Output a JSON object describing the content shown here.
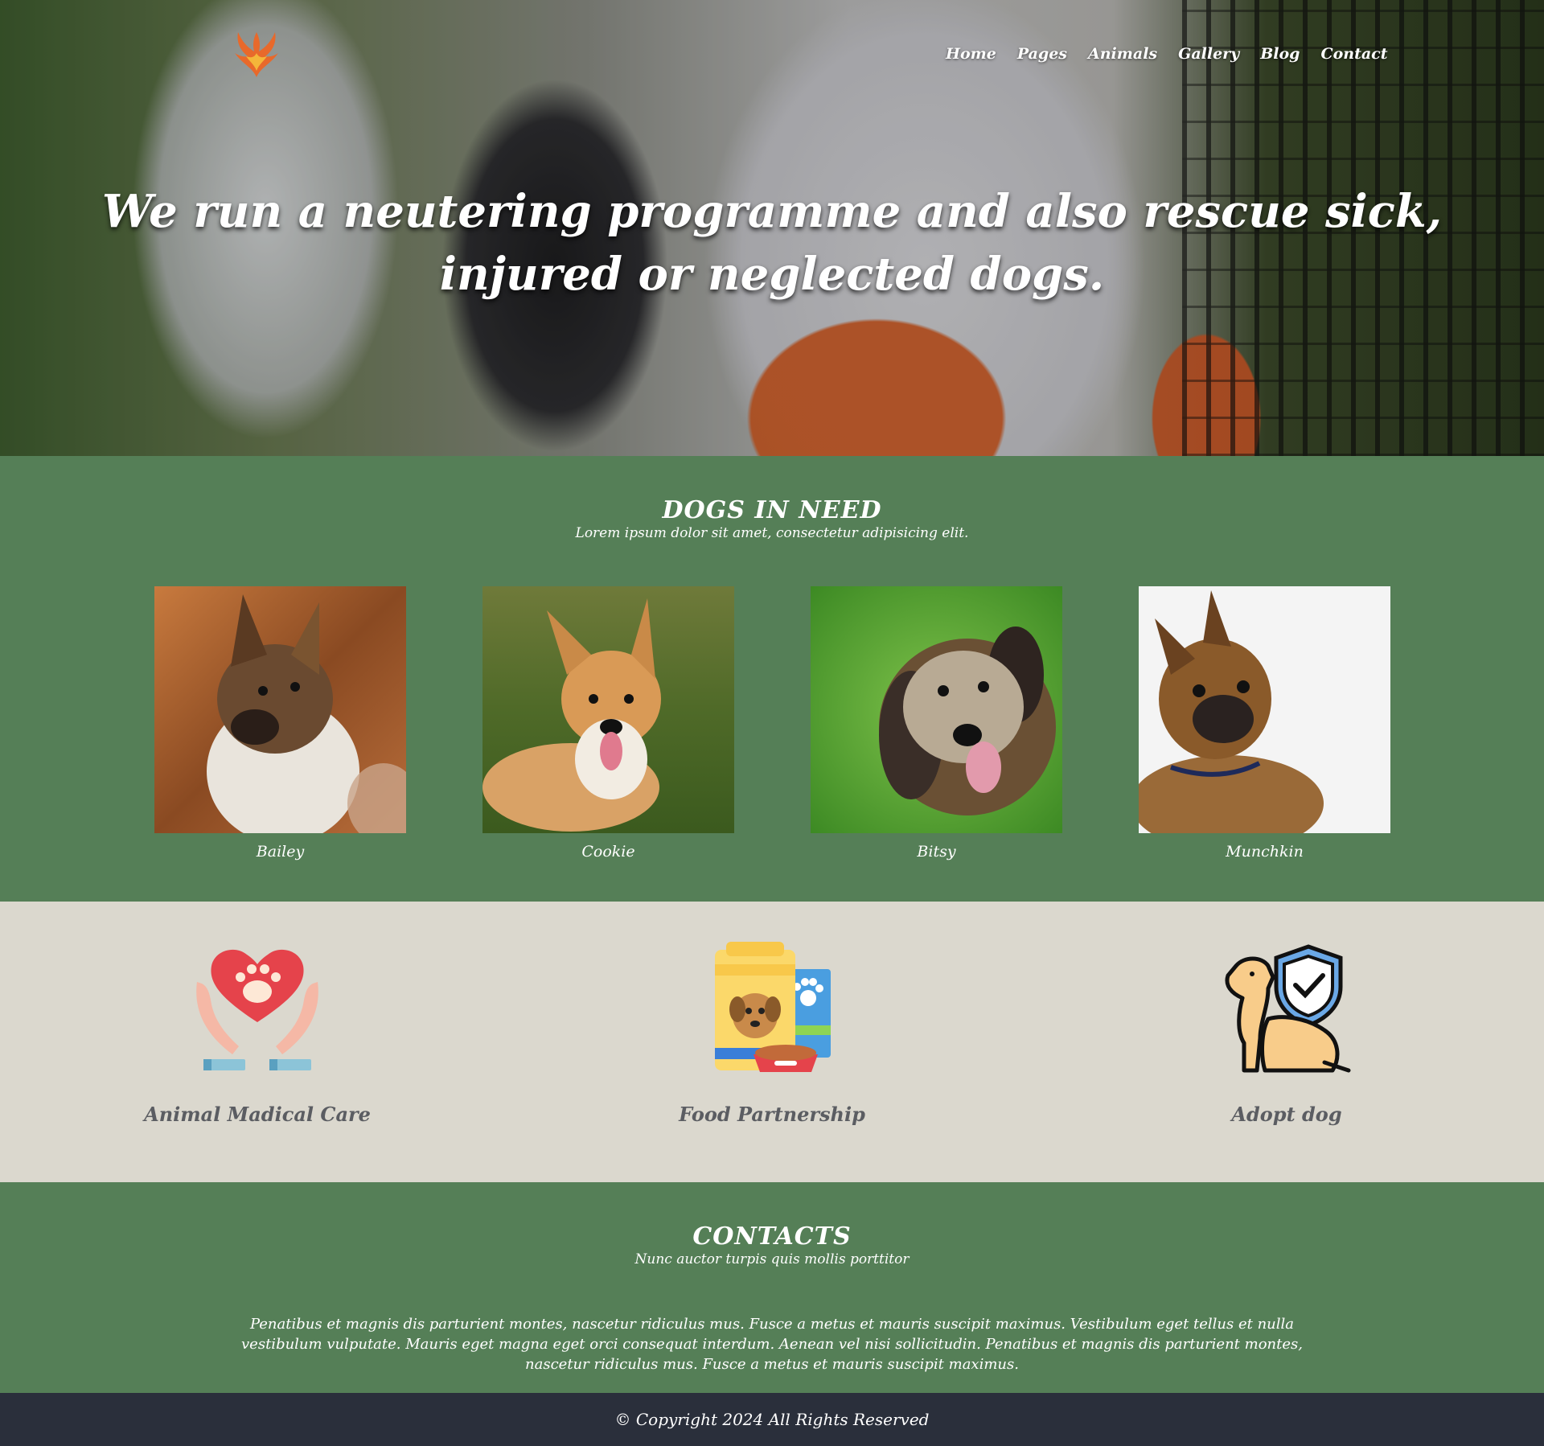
{
  "nav": {
    "items": [
      {
        "label": "Home"
      },
      {
        "label": "Pages"
      },
      {
        "label": "Animals"
      },
      {
        "label": "Gallery"
      },
      {
        "label": "Blog"
      },
      {
        "label": "Contact"
      }
    ]
  },
  "hero": {
    "heading": "We run a neutering programme and also rescue sick, injured or neglected dogs."
  },
  "dogs_section": {
    "title": "DOGS IN NEED",
    "subtitle": "Lorem ipsum dolor sit amet, consectetur adipisicing elit.",
    "dogs": [
      {
        "name": "Bailey"
      },
      {
        "name": "Cookie"
      },
      {
        "name": "Bitsy"
      },
      {
        "name": "Munchkin"
      }
    ]
  },
  "services": {
    "items": [
      {
        "label": "Animal Madical Care",
        "icon": "heart-paw-hands-icon"
      },
      {
        "label": "Food Partnership",
        "icon": "pet-food-icon"
      },
      {
        "label": "Adopt dog",
        "icon": "dog-shield-icon"
      }
    ]
  },
  "contacts": {
    "title": "CONTACTS",
    "subtitle": "Nunc auctor turpis quis mollis porttitor",
    "body": "Penatibus et magnis dis parturient montes, nascetur ridiculus mus. Fusce a metus et mauris suscipit maximus. Vestibulum eget tellus et nulla vestibulum vulputate. Mauris eget magna eget orci consequat interdum. Aenean vel nisi sollicitudin. Penatibus et magnis dis parturient montes, nascetur ridiculus mus. Fusce a metus et mauris suscipit maximus."
  },
  "footer": {
    "copyright": "© Copyright 2024 All Rights Reserved"
  },
  "colors": {
    "green_section": "#557f57",
    "beige_section": "#dbd8ce",
    "footer_bg": "#2a2f3b",
    "service_text": "#5b5d62"
  }
}
